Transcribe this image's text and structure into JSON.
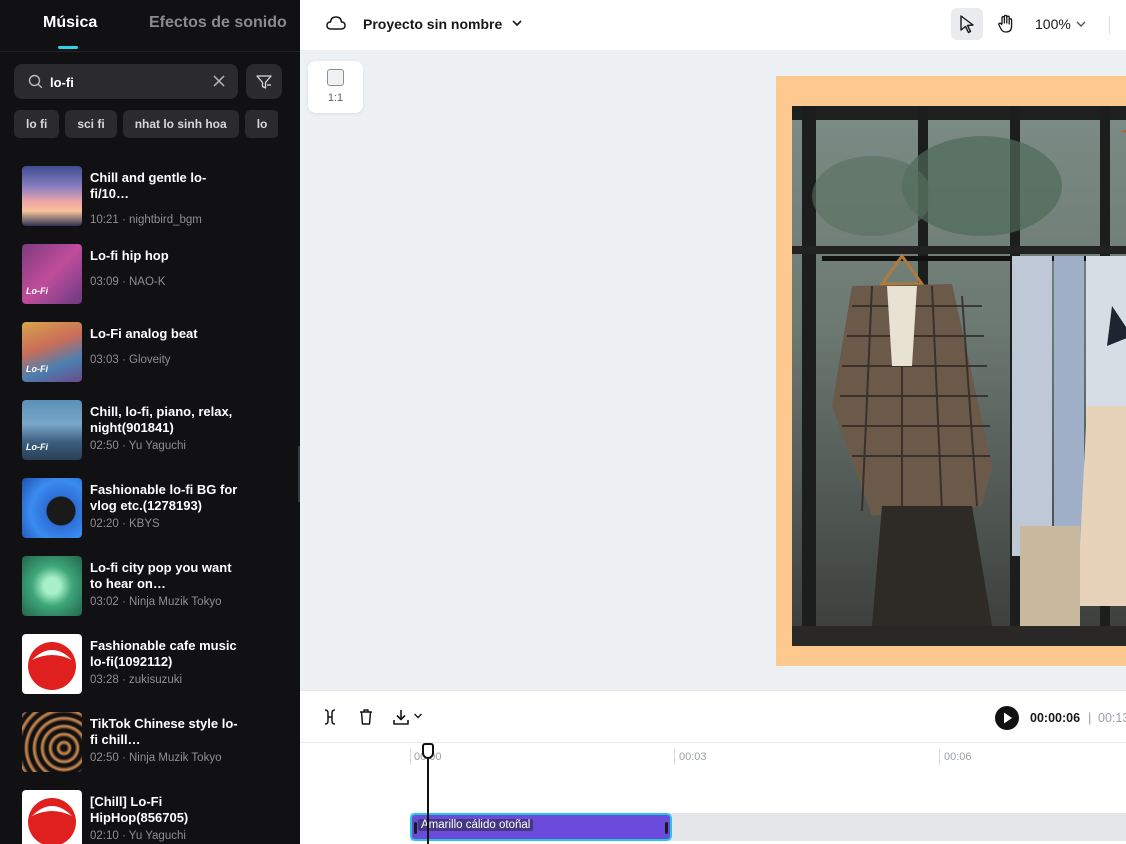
{
  "sidebar": {
    "tabs": [
      {
        "label": "Música",
        "active": true
      },
      {
        "label": "Efectos de sonido",
        "active": false
      }
    ],
    "search": {
      "value": "lo-fi",
      "placeholder": ""
    },
    "chips": [
      "lo fi",
      "sci fi",
      "nhat lo sinh hoa",
      "lo"
    ],
    "tracks": [
      {
        "title": "Chill and gentle lo-fi/10…",
        "meta": "10:21 · nightbird_bgm",
        "thumb_tag": ""
      },
      {
        "title": "Lo-fi hip hop",
        "meta": "03:09 · NAO-K",
        "thumb_tag": "Lo-Fi"
      },
      {
        "title": "Lo-Fi analog beat",
        "meta": "03:03 · Gloveity",
        "thumb_tag": "Lo-Fi"
      },
      {
        "title": "Chill, lo-fi, piano, relax, night(901841)",
        "meta": "02:50 · Yu Yaguchi",
        "thumb_tag": "Lo-Fi"
      },
      {
        "title": "Fashionable lo-fi BG for vlog etc.(1278193)",
        "meta": "02:20 · KBYS",
        "thumb_tag": ""
      },
      {
        "title": "Lo-fi city pop you want to hear on…",
        "meta": "03:02 · Ninja Muzik Tokyo",
        "thumb_tag": ""
      },
      {
        "title": "Fashionable cafe music lo-fi(1092112)",
        "meta": "03:28 · zukisuzuki",
        "thumb_tag": ""
      },
      {
        "title": "TikTok Chinese style lo-fi chill…",
        "meta": "02:50 · Ninja Muzik Tokyo",
        "thumb_tag": ""
      },
      {
        "title": "[Chill] Lo-Fi HipHop(856705)",
        "meta": "02:10 · Yu Yaguchi",
        "thumb_tag": ""
      }
    ]
  },
  "topbar": {
    "project_name": "Proyecto sin nombre",
    "zoom": "100%"
  },
  "canvas": {
    "ratio_label": "1:1"
  },
  "timeline": {
    "current_time": "00:00:06",
    "separator": "|",
    "total_time": "00:13",
    "ticks": [
      "00:00",
      "00:03",
      "00:06"
    ],
    "clip_label": "Amarillo cálido otoñal",
    "colors": {
      "clip": "#6a4bdb",
      "clip_border": "#29c6e0",
      "accent": "#2bd3e6"
    }
  }
}
